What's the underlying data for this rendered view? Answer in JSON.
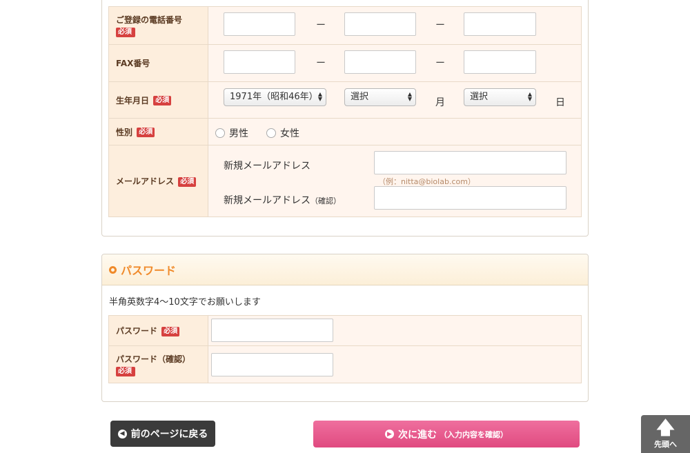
{
  "personal": {
    "phone": {
      "label": "ご登録の電話番号",
      "required": "必須",
      "separator": "ー"
    },
    "fax": {
      "label": "FAX番号",
      "separator": "ー"
    },
    "birthday": {
      "label": "生年月日",
      "required": "必須",
      "year_value": "1971年（昭和46年）",
      "month_value": "選択",
      "month_unit": "月",
      "day_value": "選択",
      "day_unit": "日"
    },
    "gender": {
      "label": "性別",
      "required": "必須",
      "option_male": "男性",
      "option_female": "女性"
    },
    "email": {
      "label": "メールアドレス",
      "required": "必須",
      "new_label": "新規メールアドレス",
      "confirm_label": "新規メールアドレス",
      "confirm_suffix": "（確認）",
      "hint": "（例：nitta@biolab.com）"
    }
  },
  "password_section": {
    "title": "パスワード",
    "note": "半角英数字4〜10文字でお願いします",
    "password_label": "パスワード",
    "password_required": "必須",
    "confirm_label": "パスワード（確認）",
    "confirm_required": "必須"
  },
  "buttons": {
    "back_icon": "◀",
    "back_label": "前のページに戻る",
    "next_icon": "▶",
    "next_label": "次に進む",
    "next_suffix": "（入力内容を確認）"
  },
  "to_top": {
    "icon": "🡅",
    "label": "先頭へ"
  },
  "select_arrows": {
    "up": "▲",
    "down": "▼"
  },
  "colors": {
    "accent_orange": "#f08a2a",
    "required_red": "#d6413f",
    "next_pink": "#e25587",
    "back_dark": "#3b3b3b"
  }
}
